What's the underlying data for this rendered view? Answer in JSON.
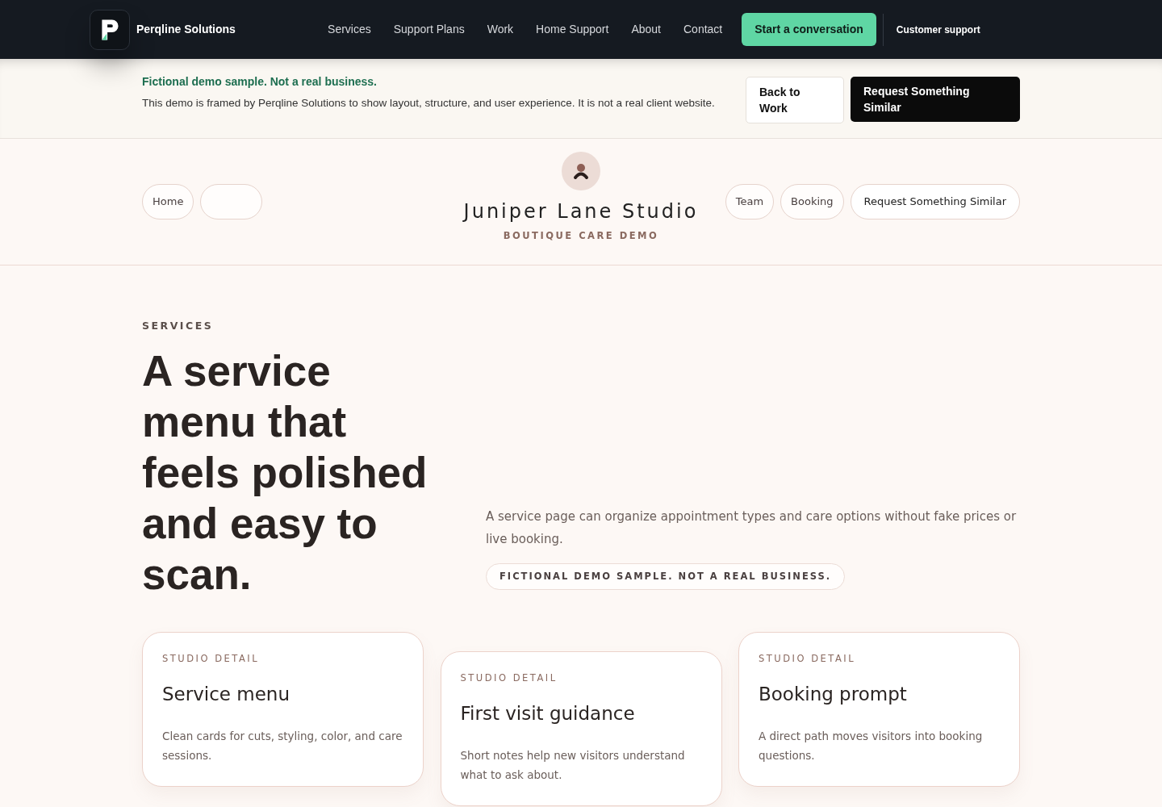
{
  "topbar": {
    "brand": "Perqline Solutions",
    "nav": [
      "Services",
      "Support Plans",
      "Work",
      "Home Support",
      "About",
      "Contact"
    ],
    "cta": "Start a conversation",
    "support": "Customer support"
  },
  "notice": {
    "title": "Fictional demo sample. Not a real business.",
    "text": "This demo is framed by Perqline Solutions to show layout, structure, and user experience. It is not a real client website.",
    "buttons": [
      {
        "label": "Back to Work",
        "kind": "light"
      },
      {
        "label": "Request Something Similar",
        "kind": "dark"
      }
    ]
  },
  "studio": {
    "name": "Juniper Lane Studio",
    "tagline": "BOUTIQUE CARE DEMO",
    "left_pills": [
      {
        "label": "Home",
        "kind": "link"
      },
      {
        "kind": "blank"
      }
    ],
    "right_pills": [
      {
        "label": "Team",
        "kind": "link"
      },
      {
        "label": "Booking",
        "kind": "link"
      },
      {
        "label": "Request Something Similar",
        "kind": "cta"
      }
    ]
  },
  "hero": {
    "eyebrow": "SERVICES",
    "heading": "A service menu that feels polished and easy to scan.",
    "text": "A service page can organize appointment types and care options without fake prices or live booking.",
    "badge": "FICTIONAL DEMO SAMPLE. NOT A REAL BUSINESS."
  },
  "cards": [
    {
      "eyebrow": "STUDIO DETAIL",
      "title": "Service menu",
      "text": "Clean cards for cuts, styling, color, and care sessions."
    },
    {
      "eyebrow": "STUDIO DETAIL",
      "title": "First visit guidance",
      "text": "Short notes help new visitors understand what to ask about."
    },
    {
      "eyebrow": "STUDIO DETAIL",
      "title": "Booking prompt",
      "text": "A direct path moves visitors into booking questions."
    }
  ]
}
